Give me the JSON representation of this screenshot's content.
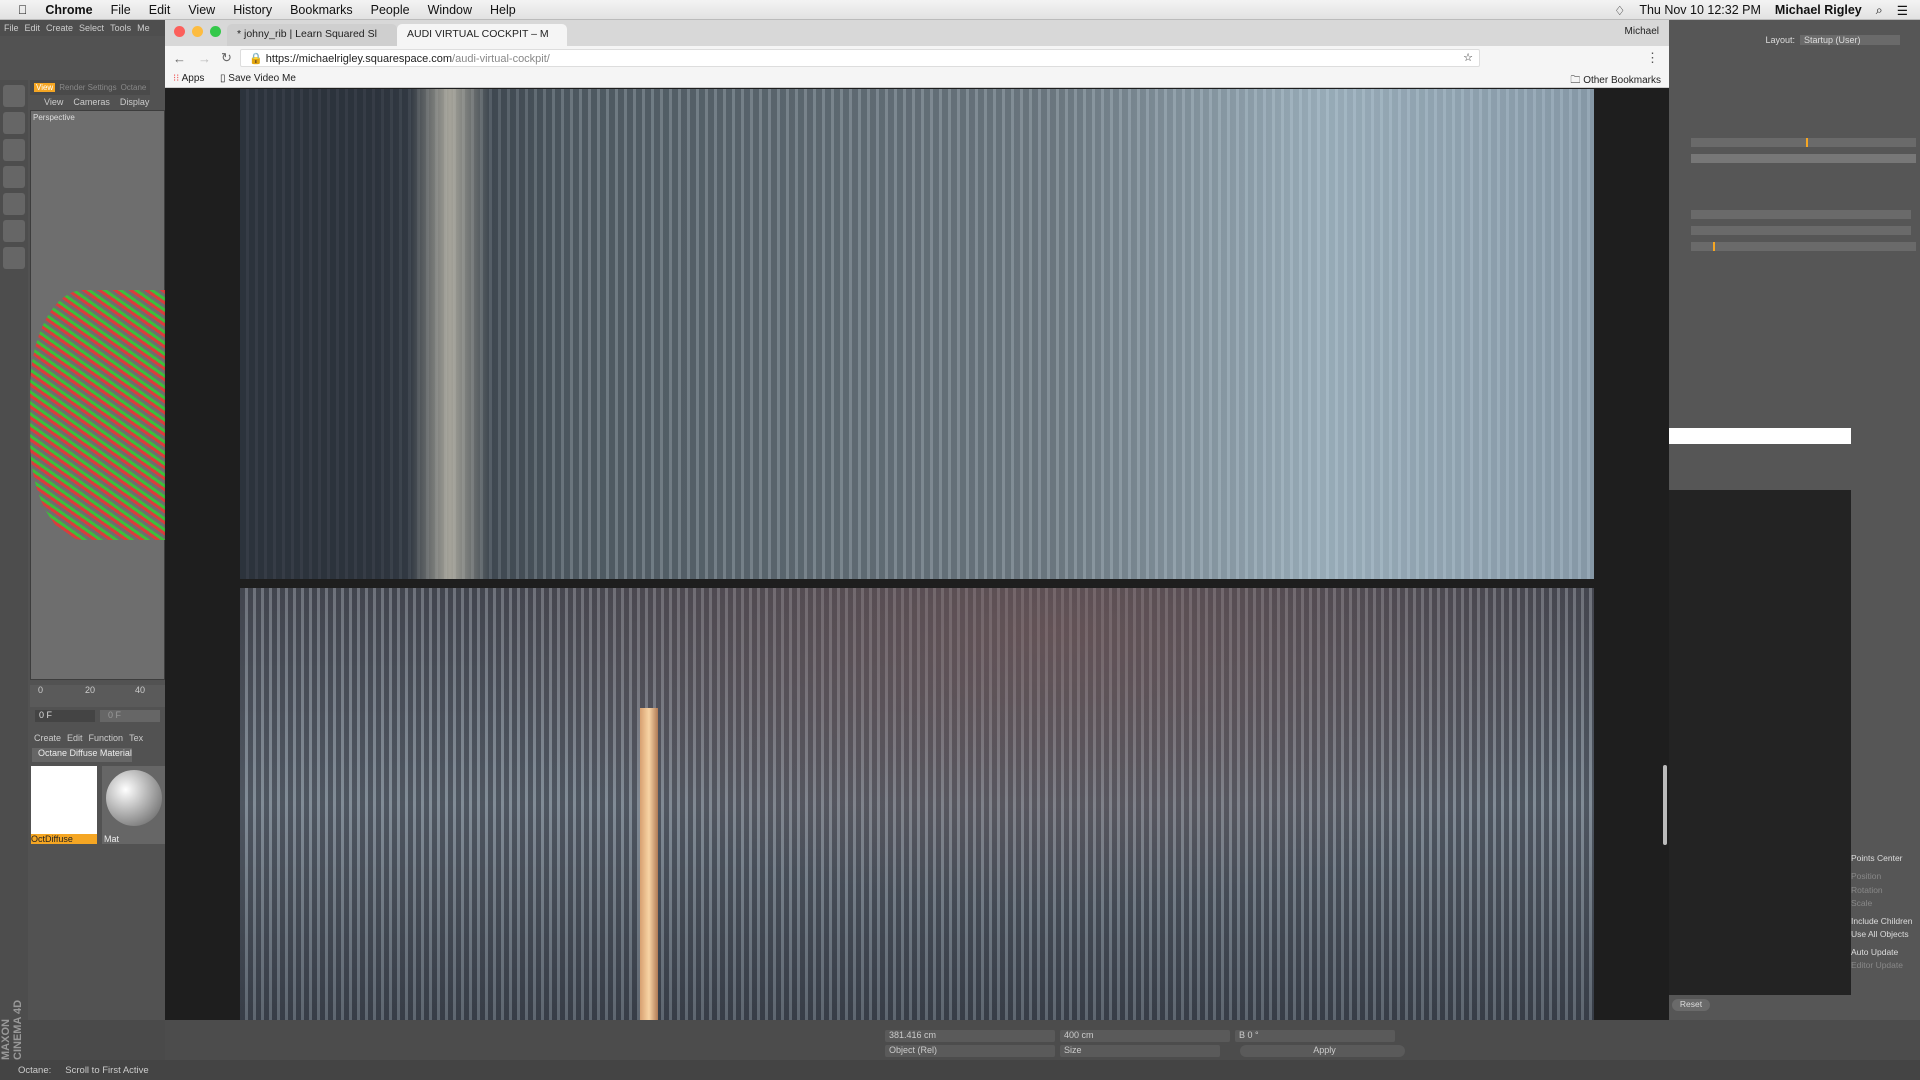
{
  "menubar": {
    "app": "Chrome",
    "items": [
      "File",
      "Edit",
      "View",
      "History",
      "Bookmarks",
      "People",
      "Window",
      "Help"
    ],
    "clock": "Thu Nov 10  12:32 PM",
    "user": "Michael Rigley"
  },
  "browser": {
    "tabs": [
      {
        "title": "* johny_rib | Learn Squared Sl"
      },
      {
        "title": "AUDI VIRTUAL COCKPIT – M"
      }
    ],
    "profile": "Michael",
    "url_host": "https://michaelrigley.squarespace.com",
    "url_path": "/audi-virtual-cockpit/",
    "bookmarks": [
      "Apps",
      "Save Video Me"
    ],
    "other_bookmarks": "Other Bookmarks"
  },
  "c4d": {
    "menu": [
      "File",
      "Edit",
      "Create",
      "Select",
      "Tools",
      "Me"
    ],
    "view_tabs": [
      "View",
      "Render Settings",
      "Octane"
    ],
    "viewport_menu": [
      "View",
      "Cameras",
      "Display"
    ],
    "viewport_label": "Perspective",
    "timeline": [
      "0",
      "20",
      "40"
    ],
    "frame": "0 F",
    "frame2": "0 F",
    "mat_menu": [
      "Create",
      "Edit",
      "Function",
      "Tex"
    ],
    "mat_tab": "Octane Diffuse Material",
    "materials": [
      "OctDiffuse",
      "Mat"
    ],
    "logo": "MAXON CINEMA 4D",
    "status": {
      "label": "Octane:",
      "text": "Scroll to First Active"
    },
    "coords": {
      "x": "381.416 cm",
      "z": "400 cm",
      "b": "B  0 °",
      "mode": "Object (Rel)",
      "size": "Size",
      "apply": "Apply"
    },
    "layout_label": "Layout:",
    "layout_value": "Startup (User)",
    "options": [
      {
        "label": "Points Center",
        "enabled": true
      },
      {
        "label": "Position",
        "enabled": false
      },
      {
        "label": "Rotation",
        "enabled": false
      },
      {
        "label": "Scale",
        "enabled": false
      },
      {
        "label": "Include Children",
        "enabled": true
      },
      {
        "label": "Use All Objects",
        "enabled": true
      },
      {
        "label": "Auto Update",
        "enabled": true
      },
      {
        "label": "Editor Update",
        "enabled": false
      }
    ],
    "reset": "Reset"
  },
  "colors": {
    "accent": "#f5a623",
    "page_bg": "#1e1e1e"
  }
}
